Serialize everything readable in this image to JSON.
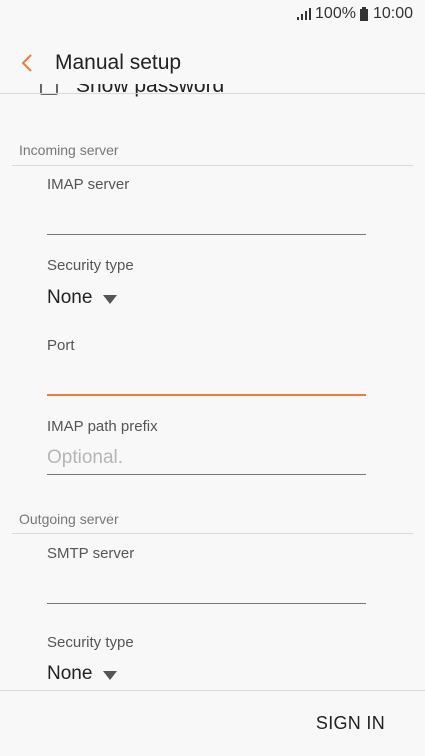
{
  "status_bar": {
    "battery_level": "100%",
    "time": "10:00"
  },
  "header": {
    "title": "Manual setup"
  },
  "show_password": {
    "label": "Show password"
  },
  "incoming": {
    "section_title": "Incoming server",
    "imap_server_label": "IMAP server",
    "imap_server_value": "",
    "security_type_label": "Security type",
    "security_type_value": "None",
    "port_label": "Port",
    "port_value": "",
    "imap_path_prefix_label": "IMAP path prefix",
    "imap_path_prefix_placeholder": "Optional."
  },
  "outgoing": {
    "section_title": "Outgoing server",
    "smtp_server_label": "SMTP server",
    "smtp_server_value": "",
    "security_type_label": "Security type",
    "security_type_value": "None"
  },
  "footer": {
    "sign_in_label": "SIGN IN"
  },
  "colors": {
    "accent": "#f07b3f",
    "background": "#f8f8f8"
  }
}
